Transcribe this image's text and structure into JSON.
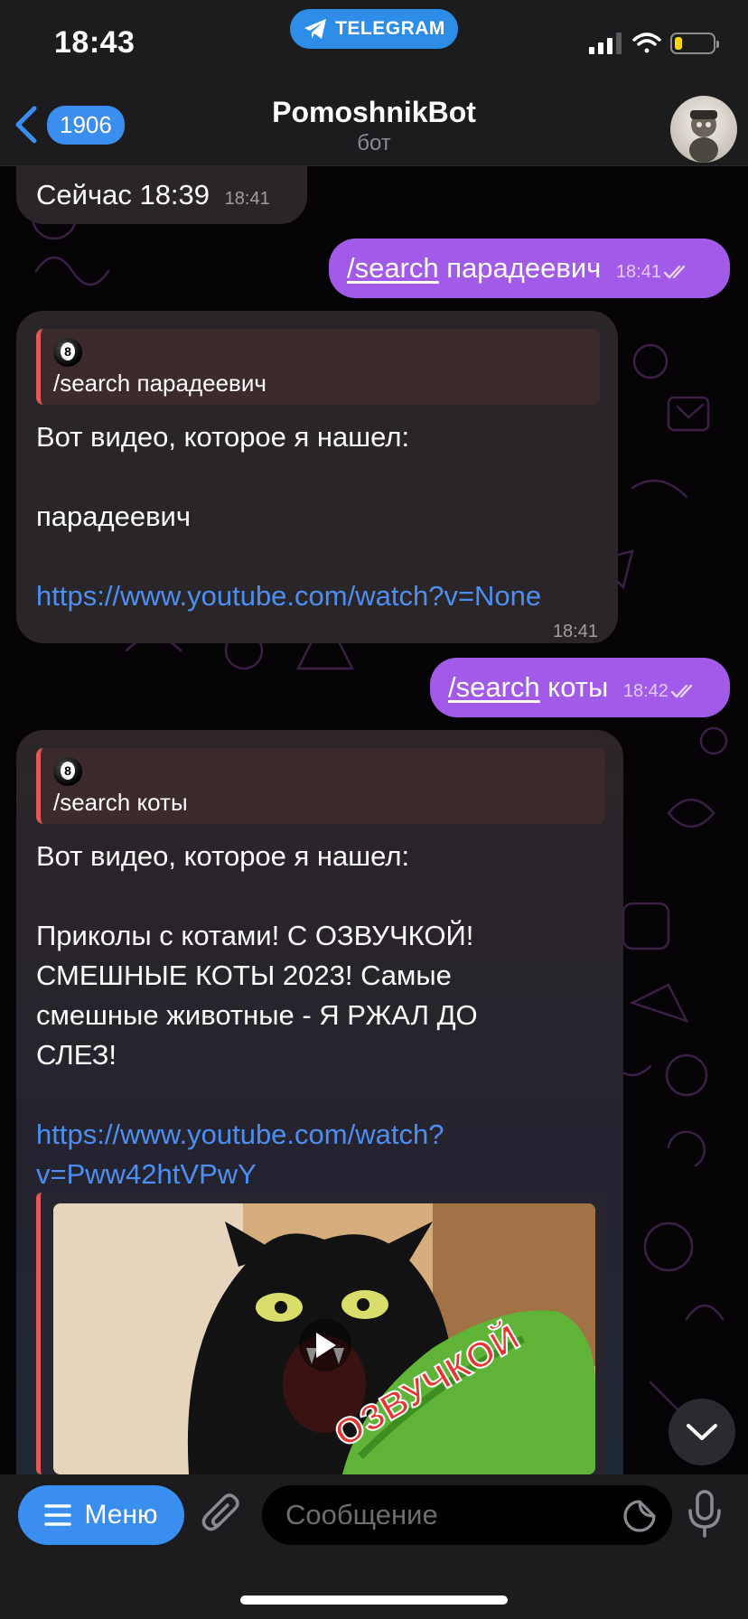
{
  "status_bar": {
    "time": "18:43",
    "app_pill": "TELEGRAM",
    "battery_level": 0.2
  },
  "header": {
    "back_count": "1906",
    "title": "PomoshnikBot",
    "subtitle": "бот"
  },
  "messages": [
    {
      "type": "in",
      "text": "Сейчас 18:39",
      "time": "18:41"
    },
    {
      "type": "out",
      "command": "/search",
      "arg": " парадеевич",
      "time": "18:41"
    },
    {
      "type": "in",
      "reply_text": "/search парадеевич",
      "line1": "Вот видео, которое я нашел:",
      "line2": "парадеевич",
      "link": "https://www.youtube.com/watch?v=None",
      "time": "18:41"
    },
    {
      "type": "out",
      "command": "/search",
      "arg": " коты",
      "time": "18:42"
    },
    {
      "type": "in",
      "reply_text": "/search коты",
      "line1": "Вот видео, которое я нашел:",
      "body": [
        "Приколы с котами! С ОЗВУЧКОЙ!",
        "СМЕШНЫЕ КОТЫ 2023!  Самые",
        "смешные животные -  Я РЖАЛ ДО",
        "СЛЕЗ!"
      ],
      "link": [
        "https://www.youtube.com/watch?",
        "v=Pww42htVPwY"
      ],
      "thumb_caption": "ОЗВУЧКОЙ"
    }
  ],
  "input": {
    "menu_label": "Меню",
    "placeholder": "Сообщение"
  },
  "colors": {
    "accent": "#3a8ef0",
    "outgoing": "#a25ae8",
    "incoming": "#2a2529",
    "link": "#4d8ff0",
    "quote_bar": "#e05a5a"
  }
}
